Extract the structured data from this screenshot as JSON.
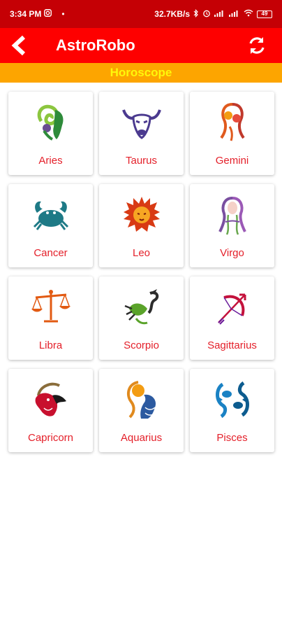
{
  "status_bar": {
    "time": "3:34 PM",
    "net_speed": "32.7KB/s",
    "battery": "49"
  },
  "app_bar": {
    "title": "AstroRobo",
    "back_icon": "back-arrow-icon",
    "refresh_icon": "refresh-icon"
  },
  "section": {
    "title": "Horoscope"
  },
  "signs": [
    {
      "label": "Aries",
      "icon": "aries-icon",
      "color": "#4caf50"
    },
    {
      "label": "Taurus",
      "icon": "taurus-icon",
      "color": "#4b3a8f"
    },
    {
      "label": "Gemini",
      "icon": "gemini-icon",
      "color": "#e05a1e"
    },
    {
      "label": "Cancer",
      "icon": "cancer-icon",
      "color": "#1e7a86"
    },
    {
      "label": "Leo",
      "icon": "leo-icon",
      "color": "#d83a14"
    },
    {
      "label": "Virgo",
      "icon": "virgo-icon",
      "color": "#7a4fa0"
    },
    {
      "label": "Libra",
      "icon": "libra-icon",
      "color": "#e25a12"
    },
    {
      "label": "Scorpio",
      "icon": "scorpio-icon",
      "color": "#5aa32a"
    },
    {
      "label": "Sagittarius",
      "icon": "sagittarius-icon",
      "color": "#c4123c"
    },
    {
      "label": "Capricorn",
      "icon": "capricorn-icon",
      "color": "#c8102e"
    },
    {
      "label": "Aquarius",
      "icon": "aquarius-icon",
      "color": "#2c5aa0"
    },
    {
      "label": "Pisces",
      "icon": "pisces-icon",
      "color": "#1a82c4"
    }
  ],
  "colors": {
    "status_bar": "#c50005",
    "app_bar": "#fe0000",
    "section_bg": "#fda500",
    "section_text": "#fff70a",
    "label_text": "#e4202a"
  }
}
